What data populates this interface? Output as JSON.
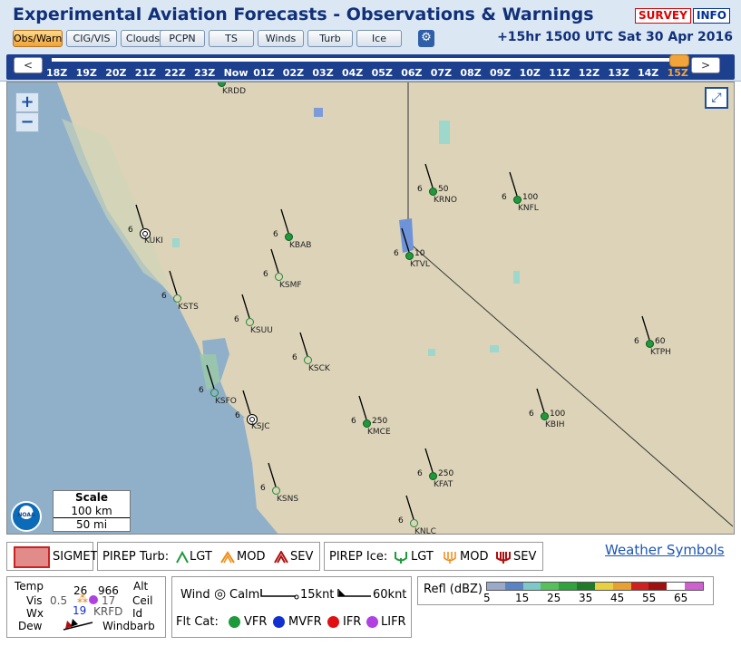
{
  "header": {
    "title": "Experimental Aviation Forecasts - Observations & Warnings",
    "survey_label": "SURVEY",
    "info_label": "INFO",
    "datetime": "+15hr 1500 UTC Sat 30 Apr 2016"
  },
  "tabs": [
    {
      "label": "Obs/Warn",
      "active": true
    },
    {
      "label": "CIG/VIS",
      "active": false
    },
    {
      "label": "Clouds",
      "active": false
    },
    {
      "label": "PCPN",
      "active": false
    },
    {
      "label": "TS",
      "active": false
    },
    {
      "label": "Winds",
      "active": false
    },
    {
      "label": "Turb",
      "active": false
    },
    {
      "label": "Ice",
      "active": false
    }
  ],
  "settings_icon": "gear-icon",
  "timeline": {
    "prev_label": "<",
    "next_label": ">",
    "ticks": [
      "18Z",
      "19Z",
      "20Z",
      "21Z",
      "22Z",
      "23Z",
      "Now",
      "01Z",
      "02Z",
      "03Z",
      "04Z",
      "05Z",
      "06Z",
      "07Z",
      "08Z",
      "09Z",
      "10Z",
      "11Z",
      "12Z",
      "13Z",
      "14Z",
      "15Z"
    ],
    "current": "15Z"
  },
  "map": {
    "zoom_in": "+",
    "zoom_out": "−",
    "expand_icon": "expand-icon",
    "scale": {
      "title": "Scale",
      "km": "100 km",
      "mi": "50 mi"
    },
    "logo": "NOAA",
    "stations": [
      {
        "id": "KRDD",
        "temp": "",
        "alt": "",
        "cat": "vfr"
      },
      {
        "id": "KUKI",
        "temp": "6",
        "alt": "",
        "cat": "calm"
      },
      {
        "id": "KBAB",
        "temp": "6",
        "alt": "",
        "cat": "vfr"
      },
      {
        "id": "KSMF",
        "temp": "6",
        "alt": "",
        "cat": "empty"
      },
      {
        "id": "KSTS",
        "temp": "6",
        "alt": "",
        "cat": "empty"
      },
      {
        "id": "KSUU",
        "temp": "6",
        "alt": "",
        "cat": "empty"
      },
      {
        "id": "KSCK",
        "temp": "6",
        "alt": "",
        "cat": "empty"
      },
      {
        "id": "KSFO",
        "temp": "6",
        "alt": "",
        "cat": "empty"
      },
      {
        "id": "KSJC",
        "temp": "6",
        "alt": "",
        "cat": "calm"
      },
      {
        "id": "KRNO",
        "temp": "6",
        "alt": "50",
        "cat": "vfr"
      },
      {
        "id": "KNFL",
        "temp": "6",
        "alt": "100",
        "cat": "vfr"
      },
      {
        "id": "KTVL",
        "temp": "6",
        "alt": "10",
        "cat": "vfr"
      },
      {
        "id": "KMCE",
        "temp": "6",
        "alt": "250",
        "cat": "vfr"
      },
      {
        "id": "KBIH",
        "temp": "6",
        "alt": "100",
        "cat": "vfr"
      },
      {
        "id": "KTPH",
        "temp": "6",
        "alt": "60",
        "cat": "vfr"
      },
      {
        "id": "KFAT",
        "temp": "6",
        "alt": "250",
        "cat": "vfr"
      },
      {
        "id": "KSNS",
        "temp": "6",
        "alt": "",
        "cat": "empty"
      },
      {
        "id": "KNLC",
        "temp": "6",
        "alt": "",
        "cat": "empty"
      }
    ]
  },
  "legend": {
    "sigmet": "SIGMET",
    "pirep_turb": {
      "label": "PIREP Turb:",
      "lgt": "LGT",
      "mod": "MOD",
      "sev": "SEV"
    },
    "pirep_ice": {
      "label": "PIREP Ice:",
      "lgt": "LGT",
      "mod": "MOD",
      "sev": "SEV"
    },
    "weather_symbols": "Weather Symbols",
    "station_model": {
      "temp": "Temp",
      "temp_val": "26",
      "alt_val": "966",
      "alt": "Alt",
      "vis": "Vis",
      "vis_val": "0.5",
      "ceil_val": "17",
      "ceil": "Ceil",
      "wx": "Wx",
      "id_val": "KRFD",
      "id": "Id",
      "dew_val": "19",
      "dew": "Dew",
      "windbarb": "Windbarb"
    },
    "wind": {
      "label": "Wind",
      "calm": "Calm",
      "k15": "15knt",
      "k60": "60knt"
    },
    "flt_cat": {
      "label": "Flt Cat:",
      "vfr": "VFR",
      "mvfr": "MVFR",
      "ifr": "IFR",
      "lifr": "LIFR"
    },
    "refl": {
      "label": "Refl (dBZ)",
      "ticks": [
        "5",
        "15",
        "25",
        "35",
        "45",
        "55",
        "65"
      ]
    },
    "colors": {
      "vfr": "#1f9a3a",
      "mvfr": "#1030d0",
      "ifr": "#e01010",
      "lifr": "#b040e0"
    }
  }
}
